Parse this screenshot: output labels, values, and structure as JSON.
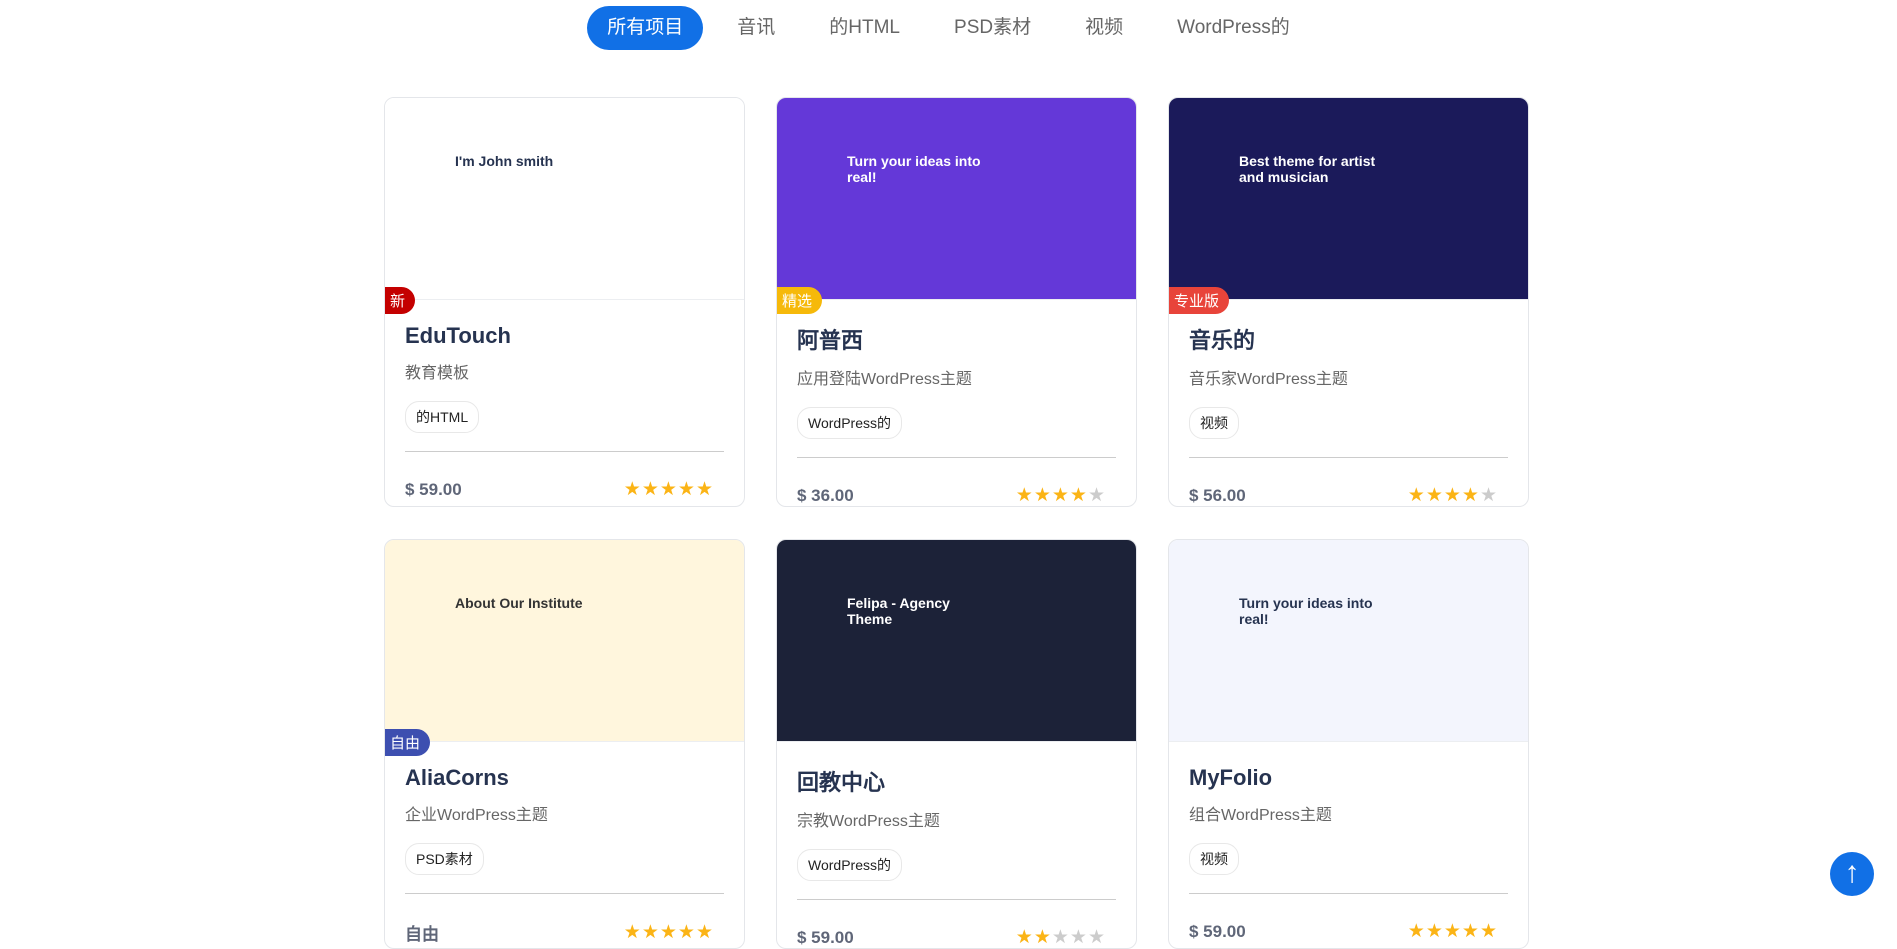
{
  "filters": {
    "items": [
      "所有项目",
      "音讯",
      "的HTML",
      "PSD素材",
      "视频",
      "WordPress的"
    ],
    "active": 0
  },
  "cards": [
    {
      "title": "EduTouch",
      "subtitle": "教育模板",
      "tag": "的HTML",
      "price": "$ 59.00",
      "rating": 5,
      "badge": "新",
      "badge_color": "#c40000",
      "thumb_text": "I'm John smith",
      "thumb_bg": "#ffffff"
    },
    {
      "title": "阿普西",
      "subtitle": "应用登陆WordPress主题",
      "tag": "WordPress的",
      "price": "$ 36.00",
      "rating": 4,
      "badge": "精选",
      "badge_color": "#f6b90a",
      "thumb_text": "Turn your ideas into real!",
      "thumb_bg": "#6438d8"
    },
    {
      "title": "音乐的",
      "subtitle": "音乐家WordPress主题",
      "tag": "视频",
      "price": "$ 56.00",
      "rating": 4,
      "badge": "专业版",
      "badge_color": "#e8443a",
      "thumb_text": "Best theme for artist and musician",
      "thumb_bg": "#1b1a5a"
    },
    {
      "title": "AliaCorns",
      "subtitle": "企业WordPress主题",
      "tag": "PSD素材",
      "price": "自由",
      "rating": 5,
      "badge": "自由",
      "badge_color": "#3d4fb0",
      "thumb_text": "About Our Institute",
      "thumb_bg": "#fff6dd"
    },
    {
      "title": "回教中心",
      "subtitle": "宗教WordPress主题",
      "tag": "WordPress的",
      "price": "$ 59.00",
      "rating": 2,
      "badge": "",
      "badge_color": "",
      "thumb_text": "Felipa - Agency Theme",
      "thumb_bg": "#1c2238"
    },
    {
      "title": "MyFolio",
      "subtitle": "组合WordPress主题",
      "tag": "视频",
      "price": "$ 59.00",
      "rating": 5,
      "badge": "",
      "badge_color": "",
      "thumb_text": "Turn your ideas into real!",
      "thumb_bg": "#f3f5fd"
    }
  ],
  "scroll_top_icon": "arrow-up-circle-icon"
}
